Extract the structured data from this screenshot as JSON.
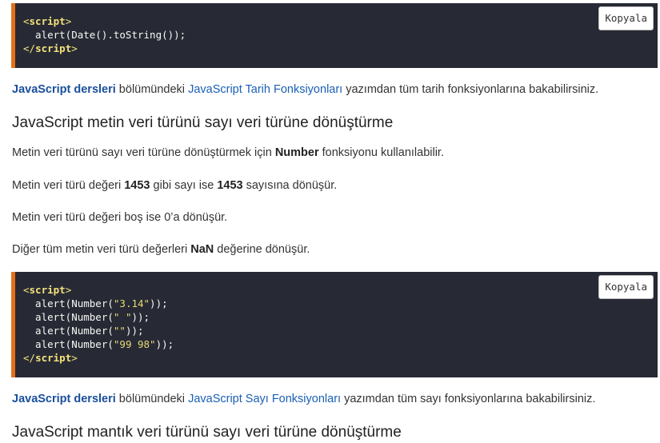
{
  "code_block_1": {
    "copy_label": "Kopyala",
    "open_tag": "script",
    "line": "  alert(Date().toString());",
    "close_tag": "script"
  },
  "para_1": {
    "link_bold": "JavaScript dersleri",
    "text_a": " bölümündeki ",
    "link": "JavaScript Tarih Fonksiyonları",
    "text_b": " yazımdan tüm tarih fonksiyonlarına bakabilirsiniz."
  },
  "heading_1": "JavaScript metin veri türünü sayı veri türüne dönüştürme",
  "para_2": {
    "text_a": "Metin veri türünü sayı veri türüne dönüştürmek için ",
    "bold": "Number",
    "text_b": " fonksiyonu kullanılabilir."
  },
  "para_3": {
    "text_a": "Metin veri türü değeri ",
    "bold_a": "1453",
    "text_b": " gibi sayı ise ",
    "bold_b": "1453",
    "text_c": " sayısına dönüşür."
  },
  "para_4": {
    "text": "Metin veri türü değeri boş ise 0’a dönüşür."
  },
  "para_5": {
    "text_a": "Diğer tüm metin veri türü değerleri ",
    "bold": "NaN",
    "text_b": " değerine dönüşür."
  },
  "code_block_2": {
    "copy_label": "Kopyala",
    "open_tag": "script",
    "close_tag": "script",
    "lines": [
      {
        "pre": "  alert(Number(",
        "str": "\"3.14\"",
        "post": "));"
      },
      {
        "pre": "  alert(Number(",
        "str": "\" \"",
        "post": "));"
      },
      {
        "pre": "  alert(Number(",
        "str": "\"\"",
        "post": "));"
      },
      {
        "pre": "  alert(Number(",
        "str": "\"99 98\"",
        "post": "));"
      }
    ]
  },
  "para_6": {
    "link_bold": "JavaScript dersleri",
    "text_a": " bölümündeki ",
    "link": "JavaScript Sayı Fonksiyonları",
    "text_b": " yazımdan tüm sayı fonksiyonlarına bakabilirsiniz."
  },
  "heading_2": "JavaScript mantık veri türünü sayı veri türüne dönüştürme"
}
